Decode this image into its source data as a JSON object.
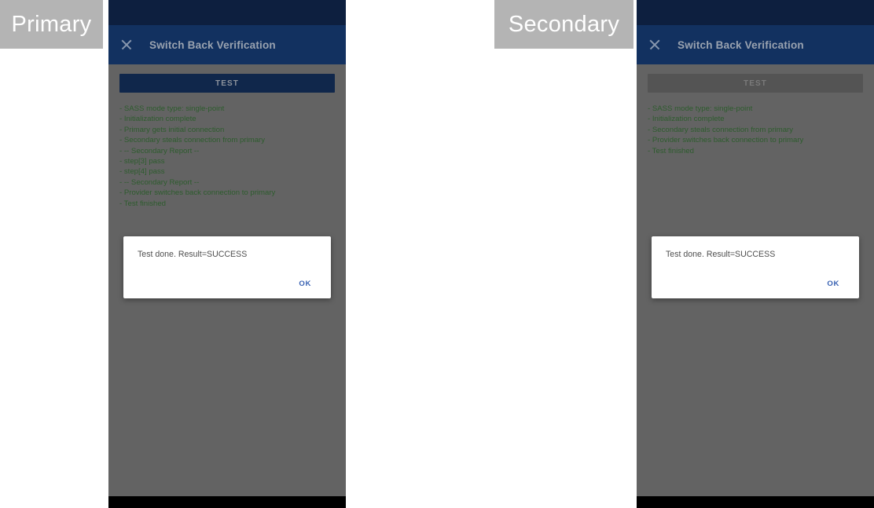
{
  "captions": {
    "primary": "Primary",
    "secondary": "Secondary"
  },
  "colors": {
    "status_bar": "#0d1f3f",
    "app_bar": "#123160",
    "panel_background": "#636363",
    "log_text": "#2d5c2d",
    "test_button_enabled": "#10274b",
    "test_button_disabled": "#545454",
    "dialog_action": "#3a63b3",
    "caption_background": "#b4b4b4",
    "nav_bar": "#000000"
  },
  "primary": {
    "app_bar": {
      "close_icon": "close-icon",
      "title": "Switch Back Verification"
    },
    "test_button": {
      "label": "TEST",
      "enabled": true
    },
    "log_lines": [
      "- SASS mode type: single-point",
      "- Initialization complete",
      "- Primary gets initial connection",
      "- Secondary steals connection from primary",
      "- -- Secondary Report --",
      "- step[3] pass",
      "- step[4] pass",
      "- -- Secondary Report --",
      "- Provider switches back connection to primary",
      "- Test finished"
    ],
    "dialog": {
      "message": "Test done. Result=SUCCESS",
      "ok_label": "OK"
    }
  },
  "secondary": {
    "app_bar": {
      "close_icon": "close-icon",
      "title": "Switch Back Verification"
    },
    "test_button": {
      "label": "TEST",
      "enabled": false
    },
    "log_lines": [
      "- SASS mode type: single-point",
      "- Initialization complete",
      "- Secondary steals connection from primary",
      "- Provider switches back connection to primary",
      "- Test finished"
    ],
    "dialog": {
      "message": "Test done. Result=SUCCESS",
      "ok_label": "OK"
    }
  }
}
